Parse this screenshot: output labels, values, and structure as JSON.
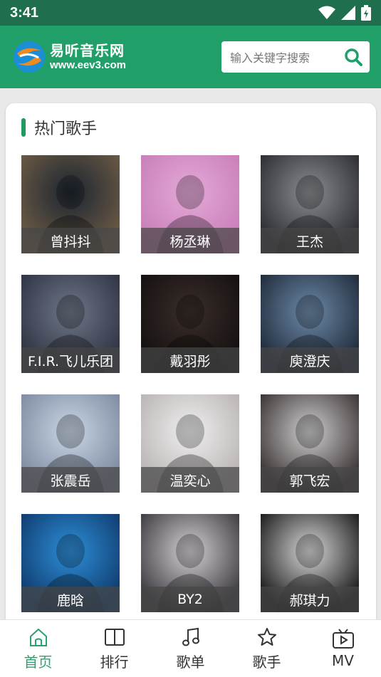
{
  "status": {
    "time": "3:41"
  },
  "brand": {
    "name": "易听音乐网",
    "url": "www.eev3.com"
  },
  "search": {
    "placeholder": "输入关键字搜索"
  },
  "section": {
    "title": "热门歌手"
  },
  "singers": [
    {
      "name": "曾抖抖",
      "tone": [
        "#1c2530",
        "#6b5a45"
      ]
    },
    {
      "name": "杨丞琳",
      "tone": [
        "#e3a9d8",
        "#c97fb8"
      ]
    },
    {
      "name": "王杰",
      "tone": [
        "#8a8d92",
        "#2b2d33"
      ]
    },
    {
      "name": "F.I.R.飞儿乐团",
      "tone": [
        "#6f7788",
        "#2e3342"
      ]
    },
    {
      "name": "戴羽彤",
      "tone": [
        "#3a2e2a",
        "#141010"
      ]
    },
    {
      "name": "庾澄庆",
      "tone": [
        "#6d8aa8",
        "#1f2a3a"
      ]
    },
    {
      "name": "张震岳",
      "tone": [
        "#c9d7e6",
        "#7d8aa0"
      ]
    },
    {
      "name": "温奕心",
      "tone": [
        "#efefef",
        "#b9b4b3"
      ]
    },
    {
      "name": "郭飞宏",
      "tone": [
        "#cfcfcf",
        "#3a3233"
      ]
    },
    {
      "name": "鹿晗",
      "tone": [
        "#2e8fd8",
        "#0f3b6e"
      ]
    },
    {
      "name": "BY2",
      "tone": [
        "#d4d0d4",
        "#3d3a40"
      ]
    },
    {
      "name": "郝琪力",
      "tone": [
        "#d8d8d8",
        "#1a1a1a"
      ]
    }
  ],
  "nav": [
    {
      "label": "首页",
      "icon": "home-icon",
      "active": true
    },
    {
      "label": "排行",
      "icon": "book-icon",
      "active": false
    },
    {
      "label": "歌单",
      "icon": "music-note-icon",
      "active": false
    },
    {
      "label": "歌手",
      "icon": "star-icon",
      "active": false
    },
    {
      "label": "MV",
      "icon": "tv-icon",
      "active": false
    }
  ],
  "colors": {
    "header": "#20a068",
    "accent": "#2aa36f",
    "statusbar": "#1f6f4f"
  }
}
